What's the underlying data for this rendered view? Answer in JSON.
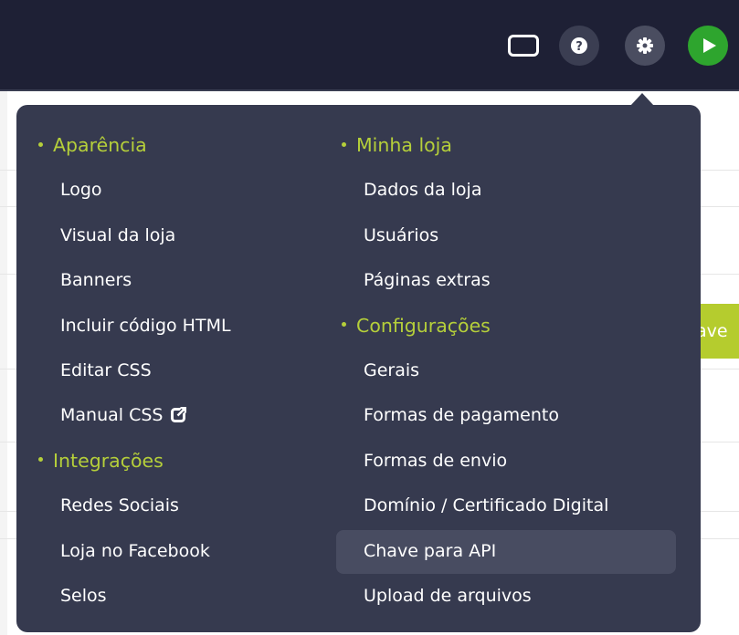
{
  "menu": {
    "left": [
      {
        "type": "heading",
        "label": "Aparência"
      },
      {
        "type": "item",
        "label": "Logo"
      },
      {
        "type": "item",
        "label": "Visual da loja"
      },
      {
        "type": "item",
        "label": "Banners"
      },
      {
        "type": "item",
        "label": "Incluir código HTML"
      },
      {
        "type": "item",
        "label": "Editar CSS"
      },
      {
        "type": "item",
        "label": "Manual CSS",
        "icon": "external-link-icon"
      },
      {
        "type": "heading",
        "label": "Integrações"
      },
      {
        "type": "item",
        "label": "Redes Sociais"
      },
      {
        "type": "item",
        "label": "Loja no Facebook"
      },
      {
        "type": "item",
        "label": "Selos"
      }
    ],
    "right": [
      {
        "type": "heading",
        "label": "Minha loja"
      },
      {
        "type": "item",
        "label": "Dados da loja"
      },
      {
        "type": "item",
        "label": "Usuários"
      },
      {
        "type": "item",
        "label": "Páginas extras"
      },
      {
        "type": "heading",
        "label": "Configurações"
      },
      {
        "type": "item",
        "label": "Gerais"
      },
      {
        "type": "item",
        "label": "Formas de pagamento"
      },
      {
        "type": "item",
        "label": "Formas de envio"
      },
      {
        "type": "item",
        "label": "Domínio / Certificado Digital"
      },
      {
        "type": "item",
        "label": "Chave para API",
        "highlighted": true
      },
      {
        "type": "item",
        "label": "Upload de arquivos"
      }
    ]
  },
  "toolbar": {
    "icons": [
      "window-icon",
      "help-icon",
      "gear-icon",
      "play-icon"
    ]
  },
  "background": {
    "partial_button_text": "ave"
  },
  "colors": {
    "topbar": "#1e2035",
    "menu_bg": "#363a4f",
    "heading": "#b5cf3a",
    "play_button": "#2ea52e",
    "highlight": "#484c61"
  }
}
